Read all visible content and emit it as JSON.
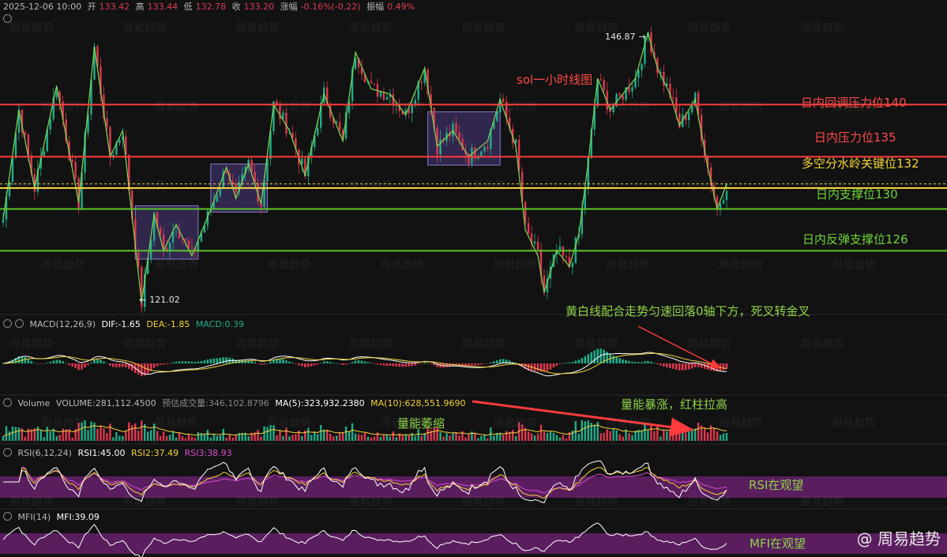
{
  "header": {
    "datetime": "2025-12-06 10:00",
    "open_label": "开",
    "open": "133.42",
    "high_label": "高",
    "high": "133.44",
    "low_label": "低",
    "low": "132.78",
    "close_label": "收",
    "close": "133.20",
    "change_label": "涨幅",
    "change": "-0.16%(-0.22)",
    "amplitude_label": "振幅",
    "amplitude": "0.49%"
  },
  "title": "sol一小时线图",
  "price_extremes": {
    "high": "146.87",
    "low": "121.02",
    "high_arrow": "→",
    "low_arrow": "←"
  },
  "levels": [
    {
      "label": "日内回调压力位140",
      "value": 140,
      "color": "#ff3b3b"
    },
    {
      "label": "日内压力位135",
      "value": 135,
      "color": "#ff3b3b"
    },
    {
      "label": "多空分水岭关键位132",
      "value": 132,
      "color": "#f5d13a"
    },
    {
      "label": "日内支撑位130",
      "value": 130,
      "color": "#5cc42a"
    },
    {
      "label": "日内反弹支撑位126",
      "value": 126,
      "color": "#5cc42a"
    }
  ],
  "macd": {
    "name": "MACD(12,26,9)",
    "dif": "DIF:-1.65",
    "dea": "DEA:-1.85",
    "macd": "MACD:0.39",
    "annotation": "黄白线配合走势匀速回落0轴下方，死叉转金叉"
  },
  "volume": {
    "name": "Volume",
    "volume": "VOLUME:281,112.4500",
    "estimate": "预估成交量:346,102.8796",
    "ma5": "MA(5):323,932.2380",
    "ma10": "MA(10):628,551.9690",
    "annotation_left": "量能萎缩",
    "annotation_right": "量能暴涨，红柱拉高"
  },
  "rsi": {
    "name": "RSI(6,12,24)",
    "rsi1": "RSI1:45.00",
    "rsi2": "RSI2:37.49",
    "rsi3": "RSI3:38.93",
    "annotation": "RSI在观望"
  },
  "mfi": {
    "name": "MFI(14)",
    "mfi": "MFI:39.09",
    "annotation": "MFI在观望"
  },
  "watermark": "周易趋势",
  "brand": "@ 周易趋势",
  "colors": {
    "up": "#1fae8a",
    "down": "#e0394f",
    "dif": "#ffffff",
    "dea": "#f5d13a",
    "rsi1": "#ffffff",
    "rsi2": "#f5d13a",
    "rsi3": "#d94bd1",
    "band": "#5a1e5e"
  },
  "chart_data": {
    "type": "candlestick",
    "interval": "1h",
    "price_range": [
      120.5,
      148.5
    ],
    "levels": [
      140,
      135,
      132,
      130,
      126
    ],
    "consolidation_boxes": [
      {
        "start": 42,
        "end": 62,
        "high": 130.3,
        "low": 125.2
      },
      {
        "start": 66,
        "end": 84,
        "high": 134.3,
        "low": 129.7
      },
      {
        "start": 135,
        "end": 158,
        "high": 139.3,
        "low": 134.2
      }
    ],
    "swing_points": [
      {
        "i": 0,
        "p": 129.0
      },
      {
        "i": 5,
        "p": 139.5
      },
      {
        "i": 10,
        "p": 132.0
      },
      {
        "i": 17,
        "p": 141.8
      },
      {
        "i": 24,
        "p": 130.6
      },
      {
        "i": 29,
        "p": 145.5
      },
      {
        "i": 34,
        "p": 135.0
      },
      {
        "i": 38,
        "p": 137.5
      },
      {
        "i": 44,
        "p": 121.02
      },
      {
        "i": 48,
        "p": 129.5
      },
      {
        "i": 51,
        "p": 126.0
      },
      {
        "i": 55,
        "p": 128.5
      },
      {
        "i": 60,
        "p": 125.5
      },
      {
        "i": 66,
        "p": 130.0
      },
      {
        "i": 71,
        "p": 134.0
      },
      {
        "i": 74,
        "p": 131.0
      },
      {
        "i": 78,
        "p": 134.3
      },
      {
        "i": 82,
        "p": 130.5
      },
      {
        "i": 86,
        "p": 140.0
      },
      {
        "i": 91,
        "p": 137.5
      },
      {
        "i": 96,
        "p": 133.2
      },
      {
        "i": 102,
        "p": 141.0
      },
      {
        "i": 108,
        "p": 136.5
      },
      {
        "i": 112,
        "p": 145.0
      },
      {
        "i": 117,
        "p": 141.5
      },
      {
        "i": 123,
        "p": 141.0
      },
      {
        "i": 128,
        "p": 139.0
      },
      {
        "i": 134,
        "p": 143.5
      },
      {
        "i": 138,
        "p": 136.0
      },
      {
        "i": 143,
        "p": 137.5
      },
      {
        "i": 148,
        "p": 135.0
      },
      {
        "i": 154,
        "p": 136.5
      },
      {
        "i": 158,
        "p": 140.5
      },
      {
        "i": 163,
        "p": 136.0
      },
      {
        "i": 166,
        "p": 128.0
      },
      {
        "i": 170,
        "p": 125.5
      },
      {
        "i": 172,
        "p": 122.0
      },
      {
        "i": 176,
        "p": 126.0
      },
      {
        "i": 180,
        "p": 124.5
      },
      {
        "i": 183,
        "p": 127.5
      },
      {
        "i": 186,
        "p": 134.5
      },
      {
        "i": 189,
        "p": 142.5
      },
      {
        "i": 193,
        "p": 139.5
      },
      {
        "i": 197,
        "p": 141.0
      },
      {
        "i": 201,
        "p": 142.5
      },
      {
        "i": 205,
        "p": 146.87
      },
      {
        "i": 208,
        "p": 143.5
      },
      {
        "i": 212,
        "p": 141.0
      },
      {
        "i": 215,
        "p": 138.0
      },
      {
        "i": 220,
        "p": 140.5
      },
      {
        "i": 224,
        "p": 134.0
      },
      {
        "i": 227,
        "p": 130.0
      },
      {
        "i": 230,
        "p": 132.4
      }
    ],
    "subcharts": [
      "MACD",
      "Volume",
      "RSI",
      "MFI"
    ]
  }
}
